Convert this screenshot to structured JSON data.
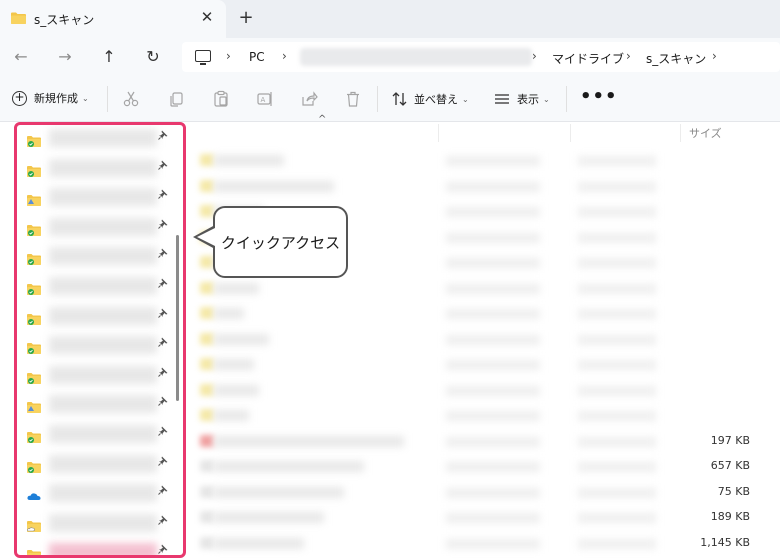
{
  "tab": {
    "title": "s_スキャン",
    "close": "✕",
    "add": "+"
  },
  "nav": {
    "back": "←",
    "forward": "→",
    "up": "↑",
    "refresh": "↻"
  },
  "address": {
    "crumbs": [
      "PC",
      "マイドライブ",
      "s_スキャン"
    ],
    "sep": "›"
  },
  "commands": {
    "new_label": "新規作成",
    "sort_label": "並べ替え",
    "view_label": "表示",
    "more": "•••",
    "chevron": "⌄"
  },
  "columns": {
    "size": "サイズ"
  },
  "sidebar": {
    "pin": "📌",
    "items": [
      {
        "icon": "folder-sync-icon"
      },
      {
        "icon": "folder-sync-icon"
      },
      {
        "icon": "folder-up-icon"
      },
      {
        "icon": "folder-sync-icon"
      },
      {
        "icon": "folder-sync-icon"
      },
      {
        "icon": "folder-sync-icon"
      },
      {
        "icon": "folder-sync-icon"
      },
      {
        "icon": "folder-sync-icon"
      },
      {
        "icon": "folder-sync-icon"
      },
      {
        "icon": "folder-up-icon"
      },
      {
        "icon": "folder-sync-icon"
      },
      {
        "icon": "folder-sync-icon"
      },
      {
        "icon": "onedrive-cloud-icon"
      },
      {
        "icon": "folder-cloud-icon"
      },
      {
        "icon": "folder-sync-icon"
      }
    ]
  },
  "callout": {
    "text": "クイックアクセス"
  },
  "files": {
    "sizes": [
      "197 KB",
      "657 KB",
      "75 KB",
      "189 KB",
      "1,145 KB"
    ]
  },
  "colors": {
    "highlight": "#e8386e",
    "folder": "#f3c64a",
    "sync": "#2aa84a",
    "cloud": "#1e7fd8"
  }
}
